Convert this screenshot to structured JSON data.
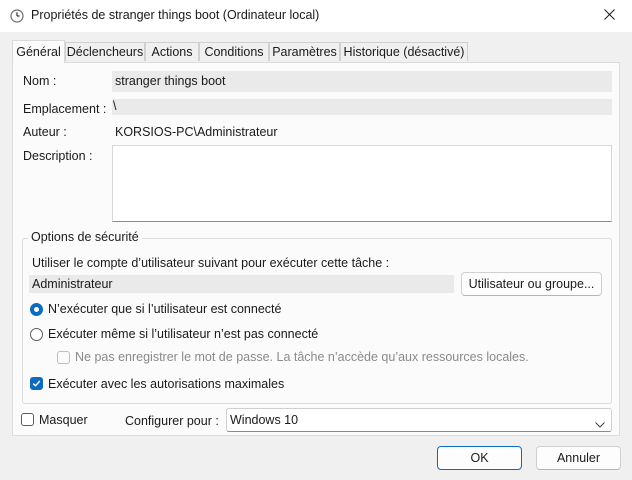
{
  "window": {
    "title": "Propriétés de stranger things boot (Ordinateur local)",
    "icon": "task-scheduler-clock-icon",
    "close_icon": "close-icon"
  },
  "tabs": [
    {
      "label": "Général",
      "active": true
    },
    {
      "label": "Déclencheurs",
      "active": false
    },
    {
      "label": "Actions",
      "active": false
    },
    {
      "label": "Conditions",
      "active": false
    },
    {
      "label": "Paramètres",
      "active": false
    },
    {
      "label": "Historique (désactivé)",
      "active": false
    }
  ],
  "general": {
    "name_label": "Nom :",
    "name_value": "stranger things boot",
    "location_label": "Emplacement :",
    "location_value": "\\",
    "author_label": "Auteur :",
    "author_value": "KORSIOS-PC\\Administrateur",
    "description_label": "Description :",
    "description_value": ""
  },
  "security": {
    "legend": "Options de sécurité",
    "account_prompt": "Utiliser le compte d’utilisateur suivant pour exécuter cette tâche :",
    "account_value": "Administrateur",
    "user_or_group_button": "Utilisateur ou groupe...",
    "radio_logged_on": {
      "label": "N’exécuter que si l’utilisateur est connecté",
      "checked": true
    },
    "radio_any": {
      "label": "Exécuter même si l’utilisateur n’est pas connecté",
      "checked": false
    },
    "no_store_password": {
      "label": "Ne pas enregistrer le mot de passe. La tâche n’accède qu’aux ressources locales.",
      "checked": false,
      "enabled": false
    },
    "highest_privileges": {
      "label": "Exécuter avec les autorisations maximales",
      "checked": true
    }
  },
  "footer": {
    "hidden": {
      "label": "Masquer",
      "checked": false
    },
    "configure_label": "Configurer pour :",
    "configure_value": "Windows 10",
    "ok_button": "OK",
    "cancel_button": "Annuler"
  },
  "colors": {
    "accent": "#0f6cbd",
    "window_bg": "#f0f0f0",
    "panel_bg": "#fbfbfb",
    "readonly_bg": "#eaeaea"
  }
}
